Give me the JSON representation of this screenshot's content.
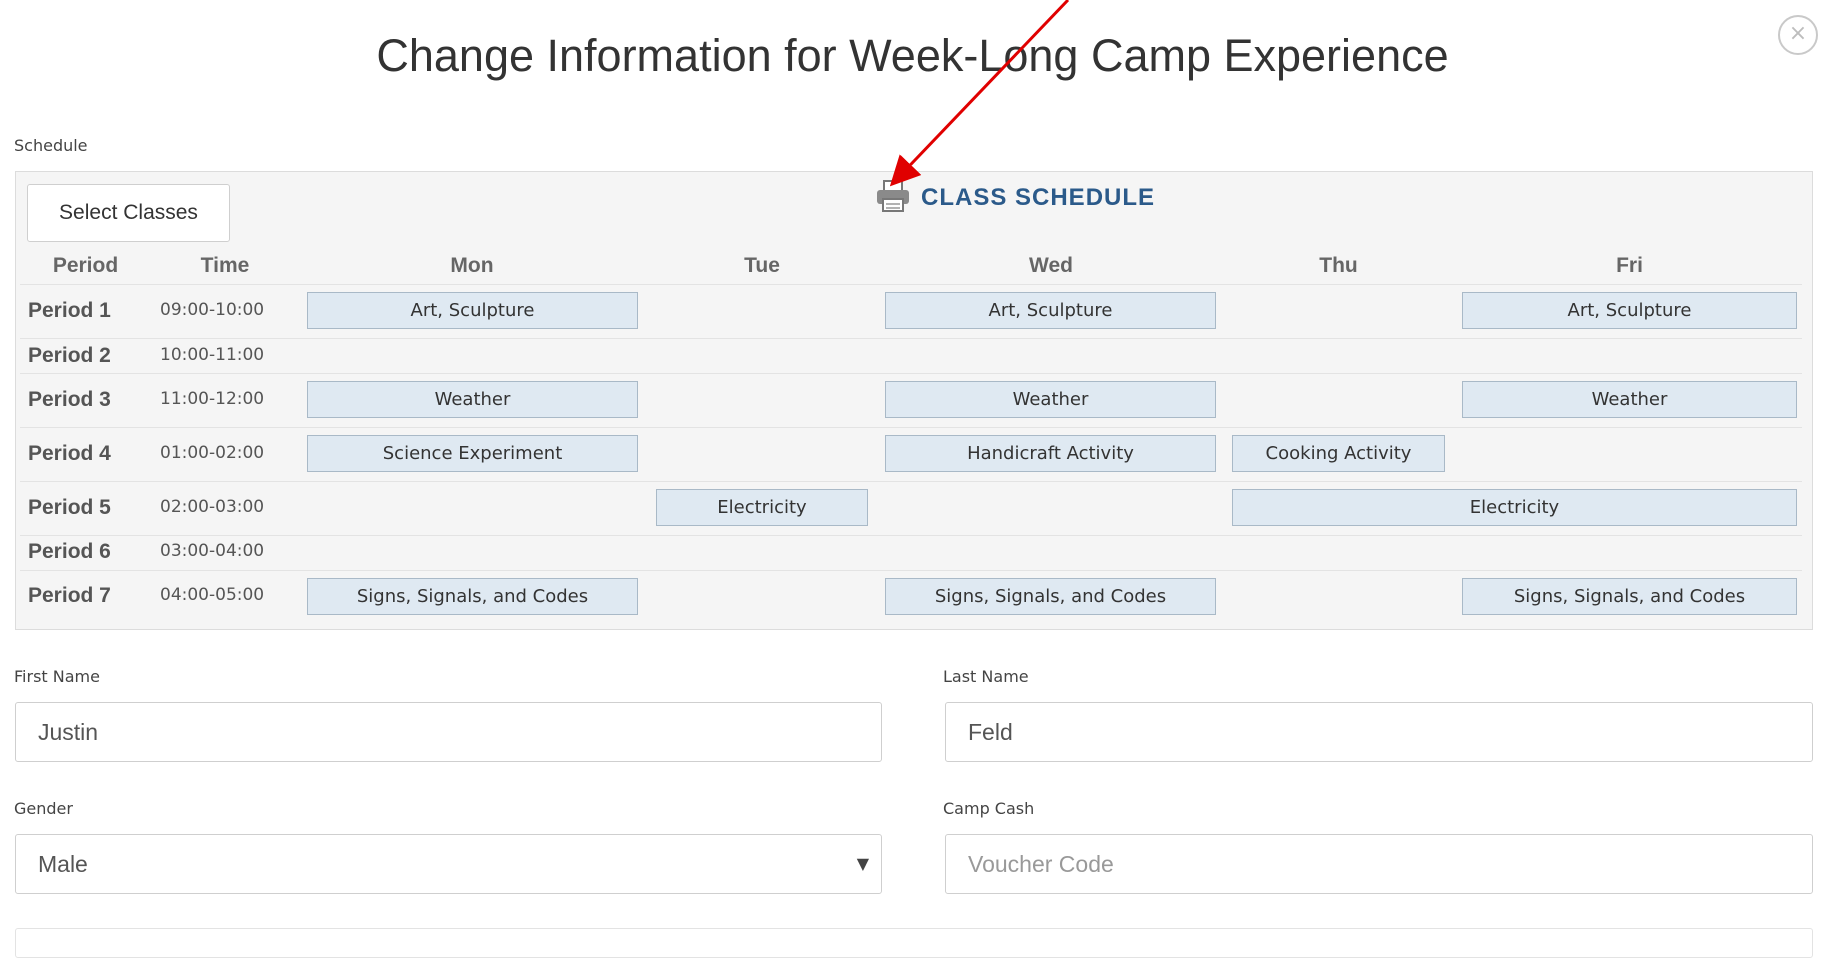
{
  "modal": {
    "title": "Change Information for Week-Long Camp Experience",
    "close_glyph": "×"
  },
  "schedule": {
    "section_label": "Schedule",
    "select_button": "Select Classes",
    "title": "CLASS SCHEDULE",
    "title_icon": "printer-icon",
    "columns": [
      "Period",
      "Time",
      "Mon",
      "Tue",
      "Wed",
      "Thu",
      "Fri"
    ],
    "rows": [
      {
        "period": "Period 1",
        "time": "09:00-10:00"
      },
      {
        "period": "Period 2",
        "time": "10:00-11:00"
      },
      {
        "period": "Period 3",
        "time": "11:00-12:00"
      },
      {
        "period": "Period 4",
        "time": "01:00-02:00"
      },
      {
        "period": "Period 5",
        "time": "02:00-03:00"
      },
      {
        "period": "Period 6",
        "time": "03:00-04:00"
      },
      {
        "period": "Period 7",
        "time": "04:00-05:00"
      }
    ],
    "classes": [
      {
        "label": "Art, Sculpture",
        "period": "Period 1",
        "day": "Mon"
      },
      {
        "label": "Art, Sculpture",
        "period": "Period 1",
        "day": "Wed"
      },
      {
        "label": "Art, Sculpture",
        "period": "Period 1",
        "day": "Fri"
      },
      {
        "label": "Weather",
        "period": "Period 3",
        "day": "Mon"
      },
      {
        "label": "Weather",
        "period": "Period 3",
        "day": "Wed"
      },
      {
        "label": "Weather",
        "period": "Period 3",
        "day": "Fri"
      },
      {
        "label": "Science Experiment",
        "period": "Period 4",
        "day": "Mon"
      },
      {
        "label": "Handicraft Activity",
        "period": "Period 4",
        "day": "Wed"
      },
      {
        "label": "Cooking Activity",
        "period": "Period 4",
        "day": "Thu"
      },
      {
        "label": "Electricity",
        "period": "Period 5",
        "day": "Tue"
      },
      {
        "label": "Electricity",
        "period": "Period 5",
        "day": "Thu-Fri"
      },
      {
        "label": "Signs, Signals, and Codes",
        "period": "Period 7",
        "day": "Mon"
      },
      {
        "label": "Signs, Signals, and Codes",
        "period": "Period 7",
        "day": "Wed"
      },
      {
        "label": "Signs, Signals, and Codes",
        "period": "Period 7",
        "day": "Fri"
      }
    ]
  },
  "form": {
    "first_name": {
      "label": "First Name",
      "value": "Justin"
    },
    "last_name": {
      "label": "Last Name",
      "value": "Feld"
    },
    "gender": {
      "label": "Gender",
      "value": "Male",
      "caret": "▼"
    },
    "camp_cash": {
      "label": "Camp Cash",
      "placeholder": "Voucher Code"
    }
  },
  "colors": {
    "annotation_arrow": "#e00000",
    "schedule_title": "#2b5a8a",
    "class_cell_bg": "#dfe9f2"
  }
}
